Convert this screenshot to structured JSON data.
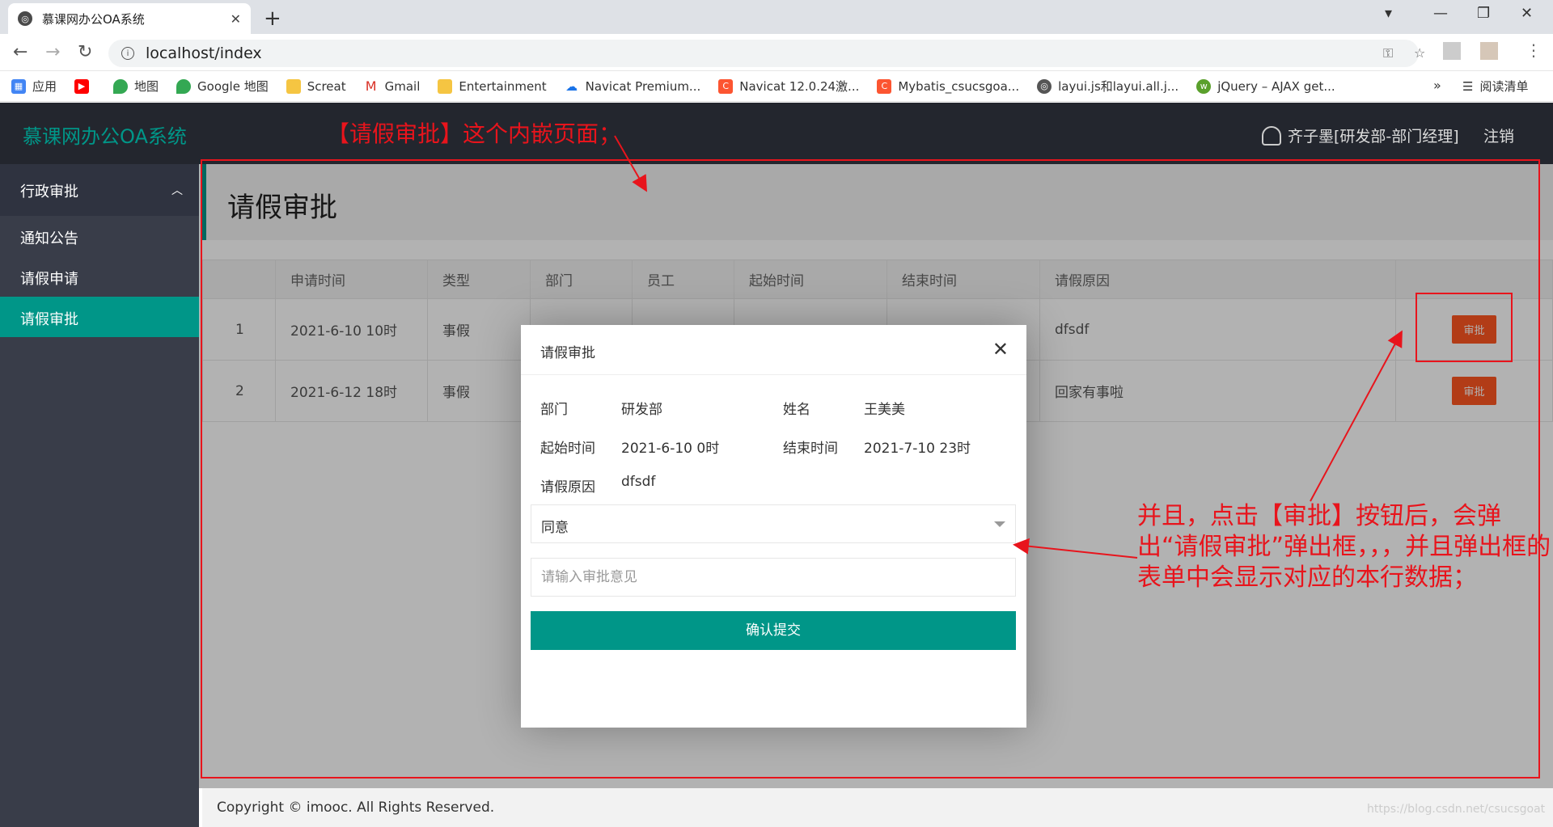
{
  "browser": {
    "tab_title": "慕课网办公OA系统",
    "url": "localhost/index",
    "bookmarks": [
      {
        "label": "应用",
        "icon": "apps-grid-icon",
        "color": "#4285f4"
      },
      {
        "label": "",
        "icon": "youtube-icon",
        "color": "#ff0000"
      },
      {
        "label": "地图",
        "icon": "maps-pin-icon",
        "color": "#34a853"
      },
      {
        "label": "Google 地图",
        "icon": "maps-pin-icon",
        "color": "#34a853"
      },
      {
        "label": "Screat",
        "icon": "folder-icon",
        "color": "#f5c542"
      },
      {
        "label": "Gmail",
        "icon": "gmail-icon",
        "color": "#d93025"
      },
      {
        "label": "Entertainment",
        "icon": "folder-icon",
        "color": "#f5c542"
      },
      {
        "label": "Navicat Premium...",
        "icon": "cloud-icon",
        "color": "#1a73e8"
      },
      {
        "label": "Navicat 12.0.24激...",
        "icon": "csdn-icon",
        "color": "#fc5531"
      },
      {
        "label": "Mybatis_csucsgoa...",
        "icon": "csdn-icon",
        "color": "#fc5531"
      },
      {
        "label": "layui.js和layui.all.j...",
        "icon": "globe-icon",
        "color": "#555555"
      },
      {
        "label": "jQuery – AJAX get...",
        "icon": "w3-icon",
        "color": "#5aa02c"
      }
    ],
    "bookmarks_more": "»",
    "reading_list": "阅读清单"
  },
  "app": {
    "logo": "慕课网办公OA系统",
    "user": "齐子墨[研发部-部门经理]",
    "logout": "注销",
    "accent": "#009688",
    "sidebar": {
      "group": "行政审批",
      "items": [
        {
          "label": "通知公告",
          "active": false
        },
        {
          "label": "请假申请",
          "active": false
        },
        {
          "label": "请假审批",
          "active": true
        }
      ]
    },
    "page_title": "请假审批",
    "table": {
      "headers": [
        "",
        "申请时间",
        "类型",
        "部门",
        "员工",
        "起始时间",
        "结束时间",
        "请假原因",
        ""
      ],
      "rows": [
        {
          "no": "1",
          "apply_time": "2021-6-10 10时",
          "type": "事假",
          "dept": "",
          "employee": "",
          "start": "",
          "end": "",
          "reason": "dfsdf",
          "action": "审批"
        },
        {
          "no": "2",
          "apply_time": "2021-6-12 18时",
          "type": "事假",
          "dept": "",
          "employee": "",
          "start": "",
          "end": "",
          "reason": "回家有事啦",
          "action": "审批"
        }
      ]
    },
    "footer": "Copyright © imooc. All Rights Reserved.",
    "watermark": "https://blog.csdn.net/csucsgoat"
  },
  "dialog": {
    "title": "请假审批",
    "close": "✕",
    "dept_label": "部门",
    "dept_value": "研发部",
    "name_label": "姓名",
    "name_value": "王美美",
    "start_label": "起始时间",
    "start_value": "2021-6-10 0时",
    "end_label": "结束时间",
    "end_value": "2021-7-10 23时",
    "reason_label": "请假原因",
    "reason_value": "dfsdf",
    "select_value": "同意",
    "opinion_placeholder": "请输入审批意见",
    "submit_label": "确认提交"
  },
  "annotations": {
    "top_note": "【请假审批】这个内嵌页面；",
    "side_note": "并且，点击【审批】按钮后，会弹出“请假审批”弹出框，，，并且弹出框的表单中会显示对应的本行数据；",
    "color": "#e8141c"
  }
}
